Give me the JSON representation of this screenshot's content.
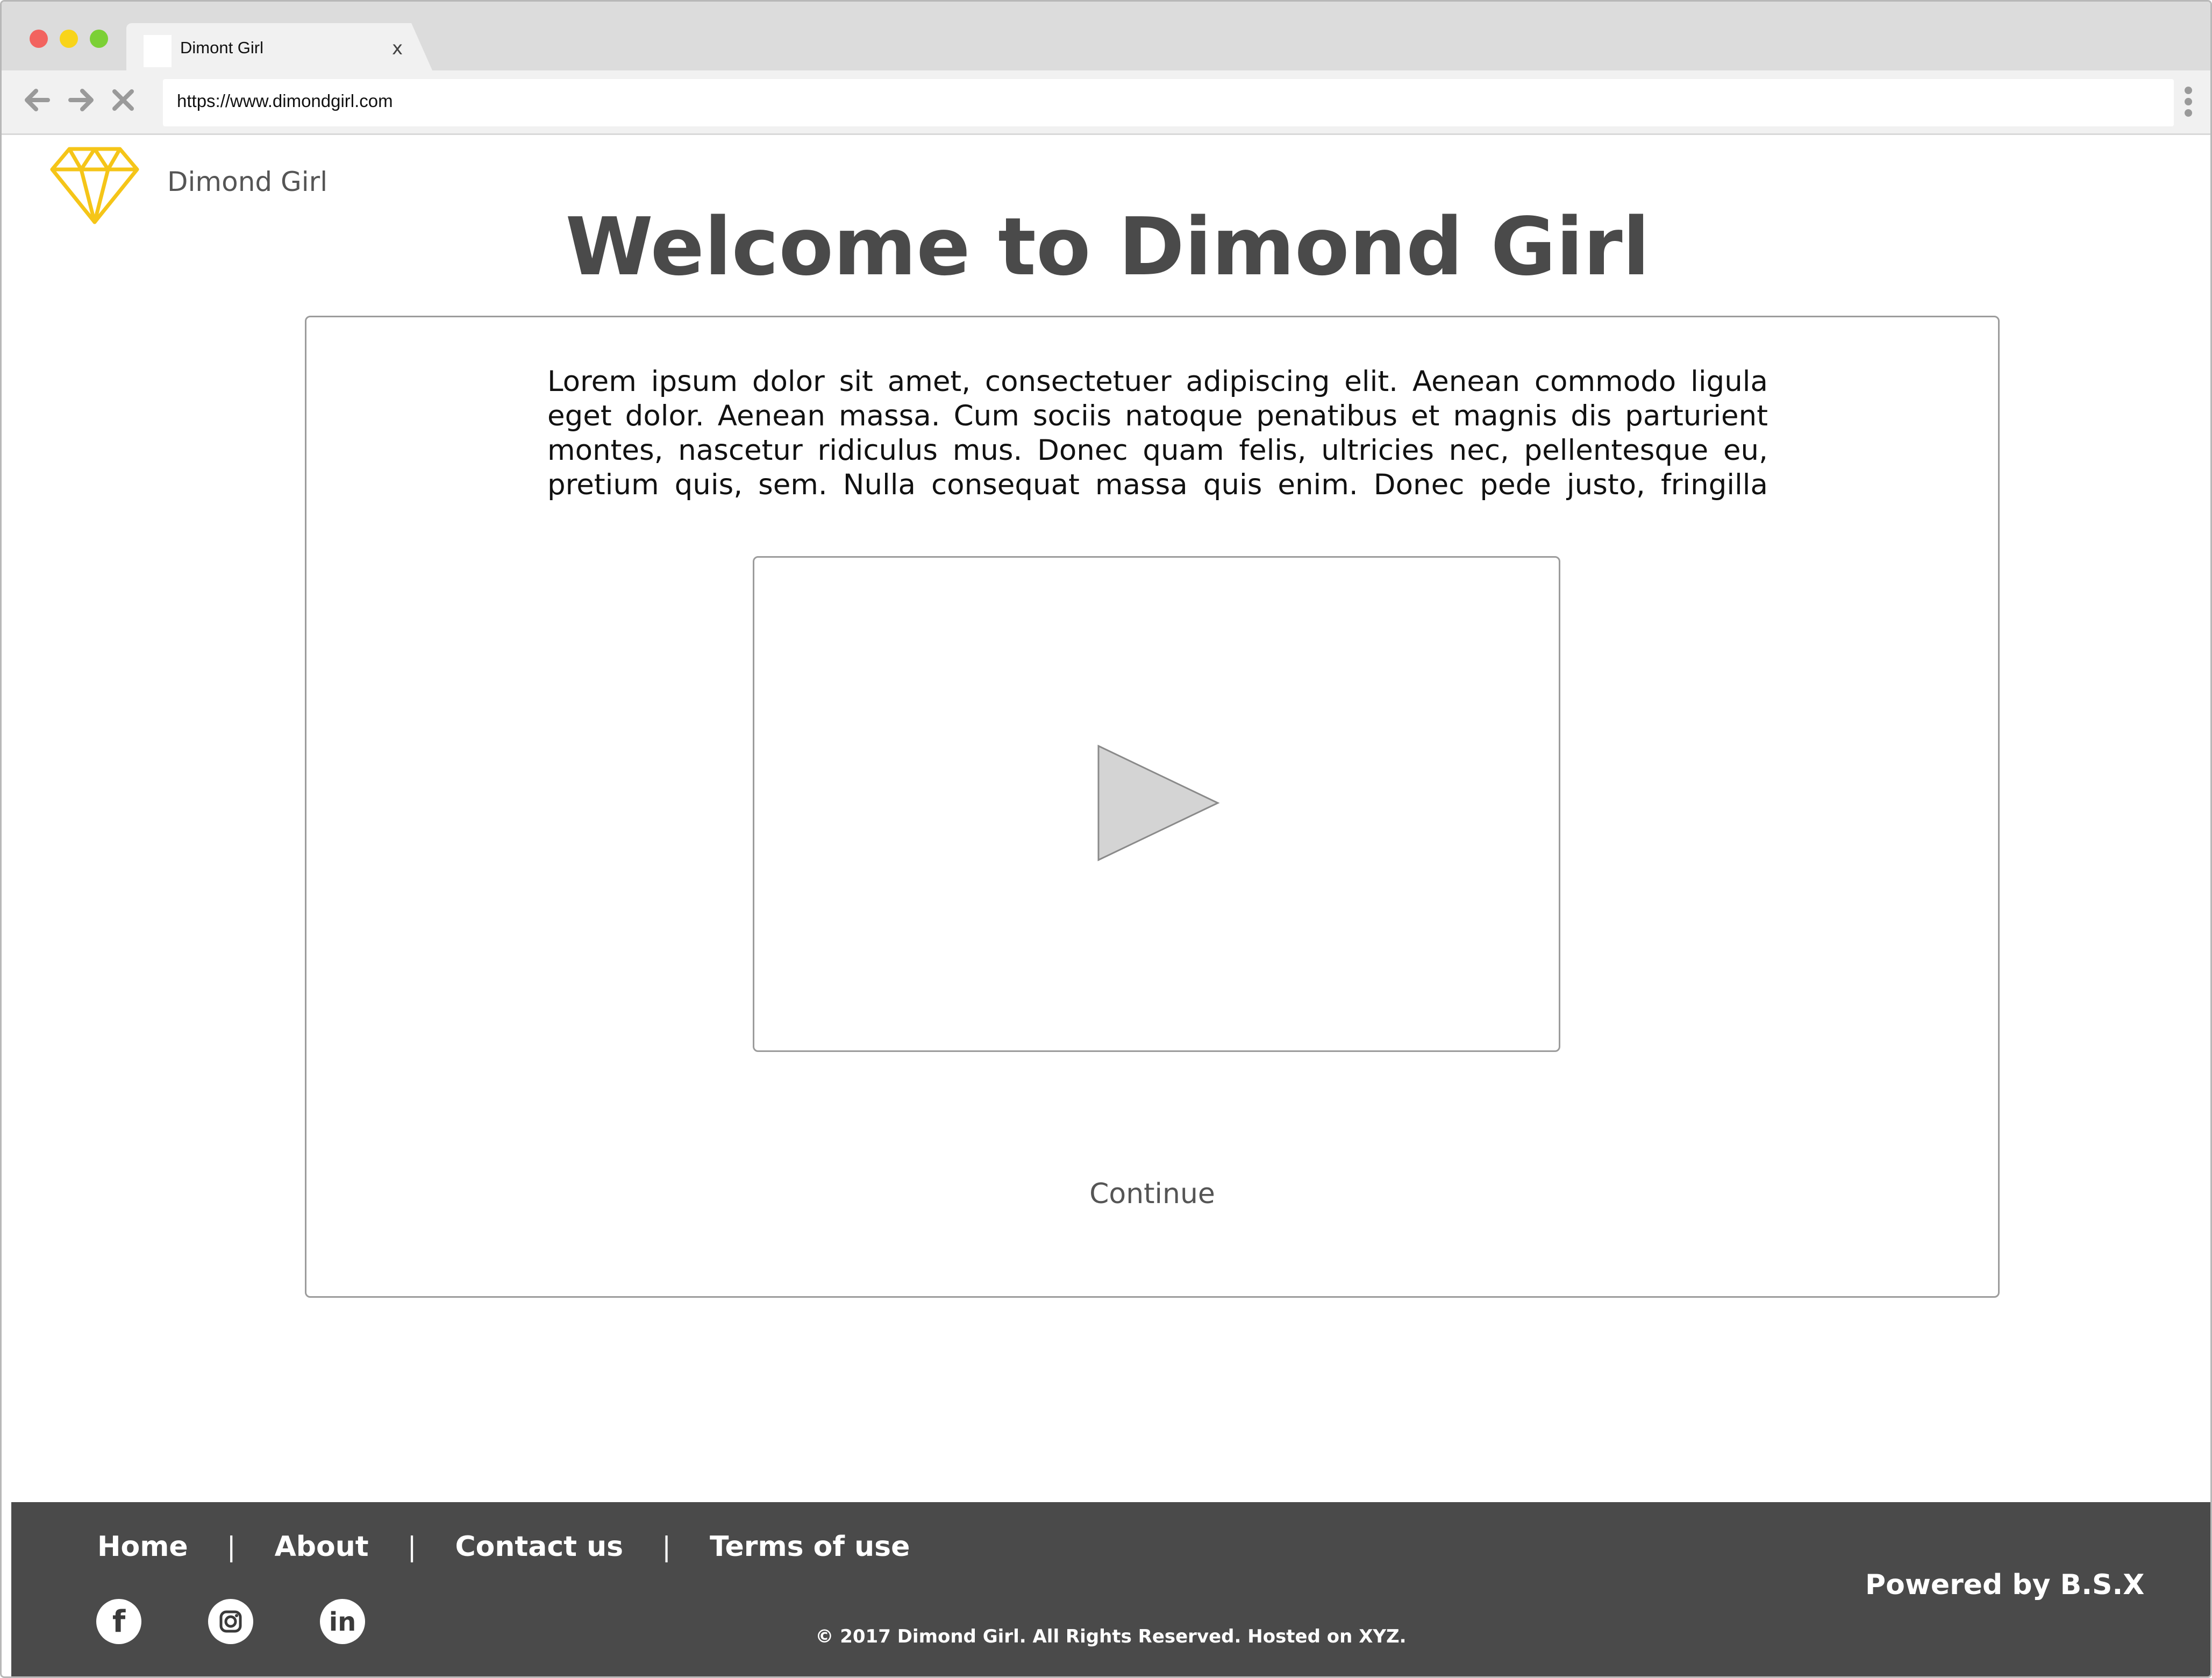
{
  "browser": {
    "tab_title": "Dimont Girl",
    "tab_close": "x",
    "url": "https://www.dimondgirl.com",
    "traffic_colors": [
      "#f2635f",
      "#f8d41a",
      "#7bd036"
    ],
    "nav_icons": [
      "back-arrow-icon",
      "forward-arrow-icon",
      "stop-icon",
      "kebab-menu-icon"
    ]
  },
  "header": {
    "logo_icon": "diamond-icon",
    "logo_color": "#f5c518",
    "site_name": "Dimond Girl",
    "welcome": "Welcome to Dimond Girl"
  },
  "main": {
    "lorem": "Lorem ipsum dolor sit amet, consectetuer adipiscing elit. Aenean commodo ligula eget dolor. Aenean massa. Cum sociis natoque penatibus et magnis dis parturient montes, nascetur ridiculus mus. Donec quam felis, ultricies nec, pellentesque eu, pretium quis, sem. Nulla consequat massa quis enim. Donec pede justo, fringilla",
    "video_icon": "play-icon",
    "continue_label": "Continue"
  },
  "footer": {
    "background": "#4a4a4a",
    "links": [
      "Home",
      "About",
      "Contact us",
      "Terms of use"
    ],
    "separator": "|",
    "social": [
      {
        "icon": "facebook-icon",
        "glyph": "f"
      },
      {
        "icon": "instagram-icon",
        "glyph": ""
      },
      {
        "icon": "linkedin-icon",
        "glyph": "in"
      }
    ],
    "copyright": "© 2017 Dimond Girl. All Rights Reserved. Hosted on XYZ.",
    "powered_by": "Powered by B.S.X"
  }
}
